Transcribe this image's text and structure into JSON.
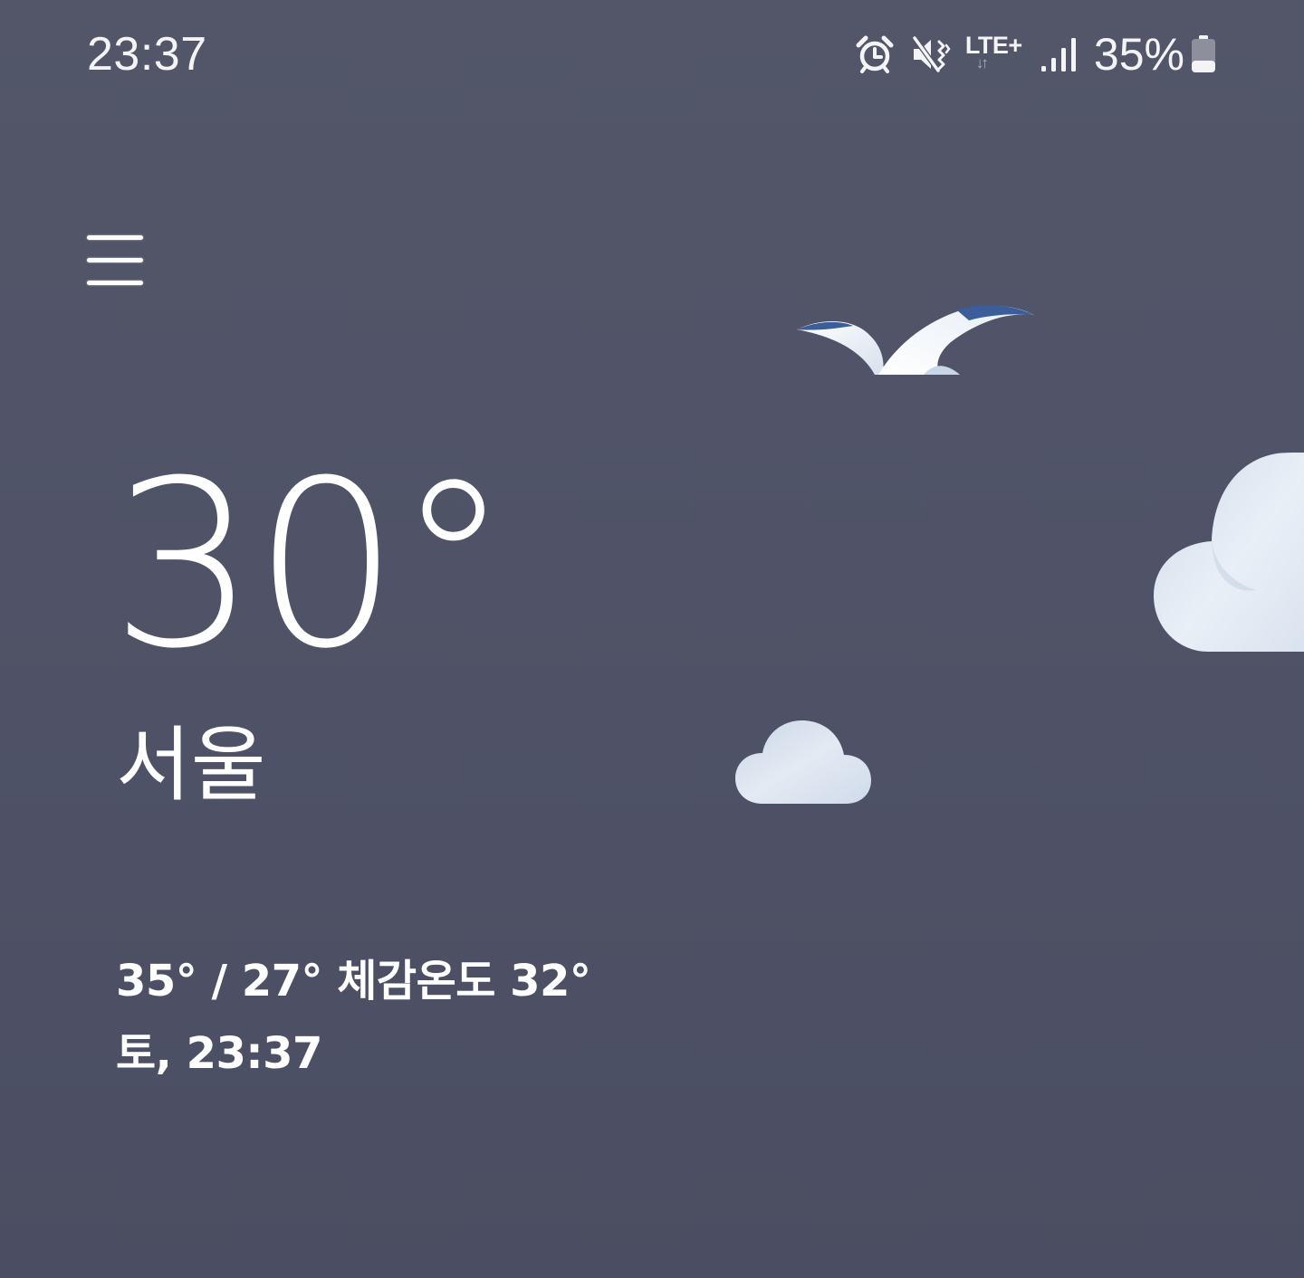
{
  "status_bar": {
    "time": "23:37",
    "icons": [
      "alarm-icon",
      "vibrate-mute-icon",
      "lte-plus-icon",
      "signal-strength-icon",
      "battery-icon"
    ],
    "network": "LTE+",
    "data_arrows": "↓↑",
    "battery_percent": "35%",
    "battery_level": 0.35
  },
  "header": {
    "menu_icon": "hamburger-menu-icon"
  },
  "weather": {
    "temperature": "30°",
    "location": "서울",
    "high_low_feels": "35° / 27° 체감온도 32°",
    "day_time": "토, 23:37"
  },
  "illustration": {
    "elements": [
      "bird-icon",
      "large-cloud-icon",
      "small-cloud-icon"
    ]
  },
  "colors": {
    "background_top": "#535669",
    "background_bottom": "#4b4e62",
    "text": "#ffffff",
    "bird_wing_tip": "#3b5e9a",
    "cloud_light": "#e8eef6",
    "cloud_shadow": "#c9d6e7"
  }
}
